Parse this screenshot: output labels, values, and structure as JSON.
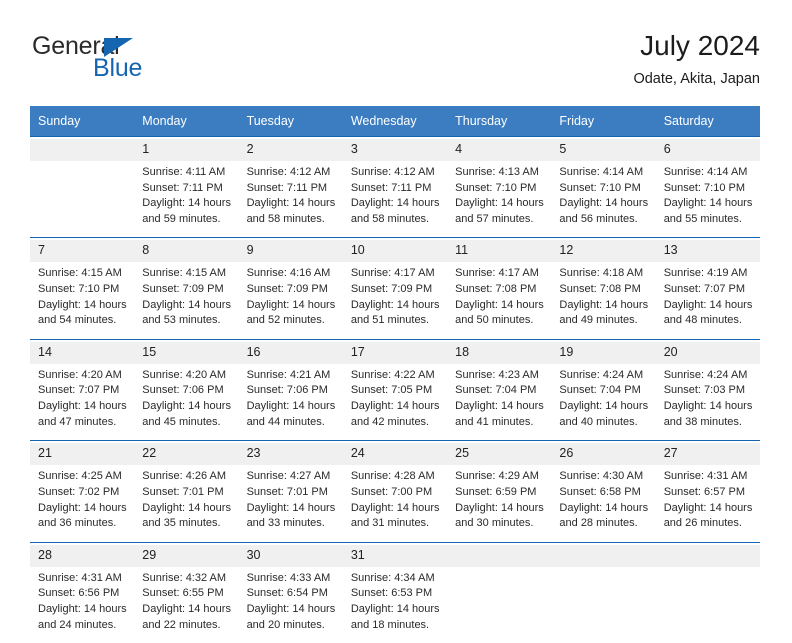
{
  "brand": {
    "name_part1": "General",
    "name_part2": "Blue",
    "triangle_color": "#1565b0"
  },
  "header": {
    "title": "July 2024",
    "location": "Odate, Akita, Japan",
    "header_bg": "#3b7dc0",
    "header_text_color": "#ffffff",
    "week_divider_color": "#1565b0",
    "daynum_bg": "#f0f0f0"
  },
  "weekdays": [
    "Sunday",
    "Monday",
    "Tuesday",
    "Wednesday",
    "Thursday",
    "Friday",
    "Saturday"
  ],
  "labels": {
    "sunrise": "Sunrise:",
    "sunset": "Sunset:",
    "daylight": "Daylight:"
  },
  "weeks": [
    [
      {
        "day": "",
        "sunrise": "",
        "sunset": "",
        "daylight": ""
      },
      {
        "day": "1",
        "sunrise": "Sunrise: 4:11 AM",
        "sunset": "Sunset: 7:11 PM",
        "daylight": "Daylight: 14 hours and 59 minutes."
      },
      {
        "day": "2",
        "sunrise": "Sunrise: 4:12 AM",
        "sunset": "Sunset: 7:11 PM",
        "daylight": "Daylight: 14 hours and 58 minutes."
      },
      {
        "day": "3",
        "sunrise": "Sunrise: 4:12 AM",
        "sunset": "Sunset: 7:11 PM",
        "daylight": "Daylight: 14 hours and 58 minutes."
      },
      {
        "day": "4",
        "sunrise": "Sunrise: 4:13 AM",
        "sunset": "Sunset: 7:10 PM",
        "daylight": "Daylight: 14 hours and 57 minutes."
      },
      {
        "day": "5",
        "sunrise": "Sunrise: 4:14 AM",
        "sunset": "Sunset: 7:10 PM",
        "daylight": "Daylight: 14 hours and 56 minutes."
      },
      {
        "day": "6",
        "sunrise": "Sunrise: 4:14 AM",
        "sunset": "Sunset: 7:10 PM",
        "daylight": "Daylight: 14 hours and 55 minutes."
      }
    ],
    [
      {
        "day": "7",
        "sunrise": "Sunrise: 4:15 AM",
        "sunset": "Sunset: 7:10 PM",
        "daylight": "Daylight: 14 hours and 54 minutes."
      },
      {
        "day": "8",
        "sunrise": "Sunrise: 4:15 AM",
        "sunset": "Sunset: 7:09 PM",
        "daylight": "Daylight: 14 hours and 53 minutes."
      },
      {
        "day": "9",
        "sunrise": "Sunrise: 4:16 AM",
        "sunset": "Sunset: 7:09 PM",
        "daylight": "Daylight: 14 hours and 52 minutes."
      },
      {
        "day": "10",
        "sunrise": "Sunrise: 4:17 AM",
        "sunset": "Sunset: 7:09 PM",
        "daylight": "Daylight: 14 hours and 51 minutes."
      },
      {
        "day": "11",
        "sunrise": "Sunrise: 4:17 AM",
        "sunset": "Sunset: 7:08 PM",
        "daylight": "Daylight: 14 hours and 50 minutes."
      },
      {
        "day": "12",
        "sunrise": "Sunrise: 4:18 AM",
        "sunset": "Sunset: 7:08 PM",
        "daylight": "Daylight: 14 hours and 49 minutes."
      },
      {
        "day": "13",
        "sunrise": "Sunrise: 4:19 AM",
        "sunset": "Sunset: 7:07 PM",
        "daylight": "Daylight: 14 hours and 48 minutes."
      }
    ],
    [
      {
        "day": "14",
        "sunrise": "Sunrise: 4:20 AM",
        "sunset": "Sunset: 7:07 PM",
        "daylight": "Daylight: 14 hours and 47 minutes."
      },
      {
        "day": "15",
        "sunrise": "Sunrise: 4:20 AM",
        "sunset": "Sunset: 7:06 PM",
        "daylight": "Daylight: 14 hours and 45 minutes."
      },
      {
        "day": "16",
        "sunrise": "Sunrise: 4:21 AM",
        "sunset": "Sunset: 7:06 PM",
        "daylight": "Daylight: 14 hours and 44 minutes."
      },
      {
        "day": "17",
        "sunrise": "Sunrise: 4:22 AM",
        "sunset": "Sunset: 7:05 PM",
        "daylight": "Daylight: 14 hours and 42 minutes."
      },
      {
        "day": "18",
        "sunrise": "Sunrise: 4:23 AM",
        "sunset": "Sunset: 7:04 PM",
        "daylight": "Daylight: 14 hours and 41 minutes."
      },
      {
        "day": "19",
        "sunrise": "Sunrise: 4:24 AM",
        "sunset": "Sunset: 7:04 PM",
        "daylight": "Daylight: 14 hours and 40 minutes."
      },
      {
        "day": "20",
        "sunrise": "Sunrise: 4:24 AM",
        "sunset": "Sunset: 7:03 PM",
        "daylight": "Daylight: 14 hours and 38 minutes."
      }
    ],
    [
      {
        "day": "21",
        "sunrise": "Sunrise: 4:25 AM",
        "sunset": "Sunset: 7:02 PM",
        "daylight": "Daylight: 14 hours and 36 minutes."
      },
      {
        "day": "22",
        "sunrise": "Sunrise: 4:26 AM",
        "sunset": "Sunset: 7:01 PM",
        "daylight": "Daylight: 14 hours and 35 minutes."
      },
      {
        "day": "23",
        "sunrise": "Sunrise: 4:27 AM",
        "sunset": "Sunset: 7:01 PM",
        "daylight": "Daylight: 14 hours and 33 minutes."
      },
      {
        "day": "24",
        "sunrise": "Sunrise: 4:28 AM",
        "sunset": "Sunset: 7:00 PM",
        "daylight": "Daylight: 14 hours and 31 minutes."
      },
      {
        "day": "25",
        "sunrise": "Sunrise: 4:29 AM",
        "sunset": "Sunset: 6:59 PM",
        "daylight": "Daylight: 14 hours and 30 minutes."
      },
      {
        "day": "26",
        "sunrise": "Sunrise: 4:30 AM",
        "sunset": "Sunset: 6:58 PM",
        "daylight": "Daylight: 14 hours and 28 minutes."
      },
      {
        "day": "27",
        "sunrise": "Sunrise: 4:31 AM",
        "sunset": "Sunset: 6:57 PM",
        "daylight": "Daylight: 14 hours and 26 minutes."
      }
    ],
    [
      {
        "day": "28",
        "sunrise": "Sunrise: 4:31 AM",
        "sunset": "Sunset: 6:56 PM",
        "daylight": "Daylight: 14 hours and 24 minutes."
      },
      {
        "day": "29",
        "sunrise": "Sunrise: 4:32 AM",
        "sunset": "Sunset: 6:55 PM",
        "daylight": "Daylight: 14 hours and 22 minutes."
      },
      {
        "day": "30",
        "sunrise": "Sunrise: 4:33 AM",
        "sunset": "Sunset: 6:54 PM",
        "daylight": "Daylight: 14 hours and 20 minutes."
      },
      {
        "day": "31",
        "sunrise": "Sunrise: 4:34 AM",
        "sunset": "Sunset: 6:53 PM",
        "daylight": "Daylight: 14 hours and 18 minutes."
      },
      {
        "day": "",
        "sunrise": "",
        "sunset": "",
        "daylight": ""
      },
      {
        "day": "",
        "sunrise": "",
        "sunset": "",
        "daylight": ""
      },
      {
        "day": "",
        "sunrise": "",
        "sunset": "",
        "daylight": ""
      }
    ]
  ]
}
